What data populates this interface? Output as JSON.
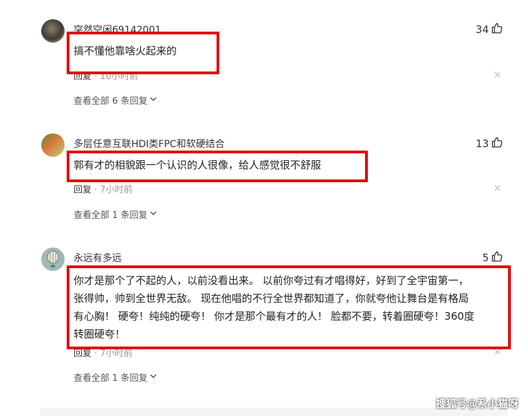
{
  "comments": [
    {
      "username": "突然空闲69142001",
      "likes": "34",
      "content": "搞不懂他靠啥火起来的",
      "reply": "回复",
      "time": "· 10小时前",
      "replies": "查看全部 6 条回复"
    },
    {
      "username": "多层任意互联HDI类FPC和软硬结合",
      "likes": "13",
      "content": "郭有才的相貌跟一个认识的人很像，给人感觉很不舒服",
      "reply": "回复",
      "time": "· 7小时前",
      "replies": "查看全部 1 条回复"
    },
    {
      "username": "永远有多远",
      "likes": "5",
      "content_lines": [
        "你才是那个了不起的人，以前没看出来。 以前你夸过有才唱得好，好到了全宇宙第一，",
        "张得帅，帅到全世界无敌。 现在他唱的不行全世界都知道了，你就夸他让舞台是有格局",
        "有心胸！ 硬夸！纯纯的硬夸！ 你才是那个最有才的人！ 脸都不要，转着圈硬夸！360度",
        "转圈硬夸！"
      ],
      "reply": "回复",
      "time": "· 7小时前",
      "replies": "查看全部 1 条回复"
    }
  ],
  "watermark": "搜狐号@系小猫呀",
  "icons": {
    "like": "thumbs-up-icon",
    "close": "close-icon",
    "chevron": "chevron-down-icon"
  },
  "colors": {
    "highlight": "#e30000"
  }
}
